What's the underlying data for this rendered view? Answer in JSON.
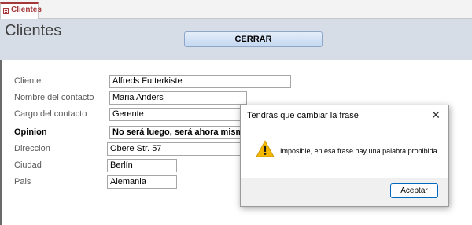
{
  "tab": {
    "label": "Clientes",
    "icon": "form-icon"
  },
  "header": {
    "title": "Clientes",
    "close_button_label": "CERRAR"
  },
  "form": {
    "fields": [
      {
        "label": "Cliente",
        "value": "Alfreds Futterkiste",
        "bold": false
      },
      {
        "label": "Nombre del contacto",
        "value": "Maria Anders",
        "bold": false
      },
      {
        "label": "Cargo del contacto",
        "value": "Gerente",
        "bold": false
      },
      {
        "label": "Opinion",
        "value": "No será luego, será ahora mismo",
        "bold": true
      },
      {
        "label": "Direccion",
        "value": "Obere Str. 57",
        "bold": false
      },
      {
        "label": "Ciudad",
        "value": "Berlín",
        "bold": false
      },
      {
        "label": "Pais",
        "value": "Alemania",
        "bold": false
      }
    ]
  },
  "dialog": {
    "title": "Tendrás que cambiar la frase",
    "close_glyph": "✕",
    "message": "Imposible, en esa frase hay una palabra prohibida",
    "icon": "warning-icon",
    "ok_label": "Aceptar"
  },
  "colors": {
    "accent": "#a4373a",
    "header_bg": "#d7dde6",
    "button_border": "#0067c0",
    "warning": "#f5b800"
  }
}
